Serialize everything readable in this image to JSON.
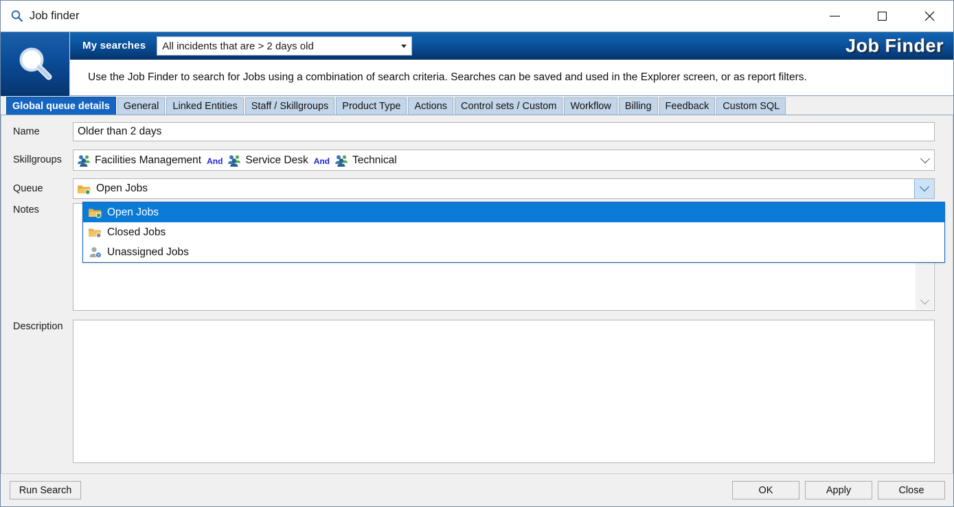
{
  "window": {
    "title": "Job finder",
    "title_icon": "search-icon",
    "controls": {
      "minimize": "minimize-icon",
      "maximize": "maximize-icon",
      "close": "close-icon"
    }
  },
  "header": {
    "logo_icon": "magnifier-logo-icon",
    "my_searches_label": "My searches",
    "saved_search_value": "All incidents that are > 2 days old",
    "brand": "Job Finder",
    "description": "Use the Job Finder to search for Jobs using a combination of search criteria.  Searches can be saved and used in the Explorer screen, or as report filters.",
    "accent_color": "#0b54a0"
  },
  "tabs": [
    {
      "label": "Global queue details",
      "active": true
    },
    {
      "label": "General",
      "active": false
    },
    {
      "label": "Linked Entities",
      "active": false
    },
    {
      "label": "Staff / Skillgroups",
      "active": false
    },
    {
      "label": "Product Type",
      "active": false
    },
    {
      "label": "Actions",
      "active": false
    },
    {
      "label": "Control sets / Custom",
      "active": false
    },
    {
      "label": "Workflow",
      "active": false
    },
    {
      "label": "Billing",
      "active": false
    },
    {
      "label": "Feedback",
      "active": false
    },
    {
      "label": "Custom SQL",
      "active": false
    }
  ],
  "form": {
    "name": {
      "label": "Name",
      "value": "Older than 2 days"
    },
    "skillgroups": {
      "label": "Skillgroups",
      "items": [
        "Facilities Management",
        "Service Desk",
        "Technical"
      ],
      "operator": "And",
      "operator_color": "#1a23d8",
      "item_icon": "people-group-icon"
    },
    "queue": {
      "label": "Queue",
      "value": "Open Jobs",
      "value_icon": "folder-open-jobs-icon",
      "expanded": true,
      "options": [
        {
          "label": "Open Jobs",
          "icon": "folder-open-jobs-icon",
          "selected": true
        },
        {
          "label": "Closed Jobs",
          "icon": "folder-closed-jobs-icon",
          "selected": false
        },
        {
          "label": "Unassigned Jobs",
          "icon": "user-unassigned-icon",
          "selected": false
        }
      ],
      "highlight_color": "#0b7bd8"
    },
    "notes": {
      "label": "Notes",
      "value": ""
    },
    "description": {
      "label": "Description",
      "value": ""
    }
  },
  "footer": {
    "run_search": "Run Search",
    "ok": "OK",
    "apply": "Apply",
    "close": "Close"
  }
}
